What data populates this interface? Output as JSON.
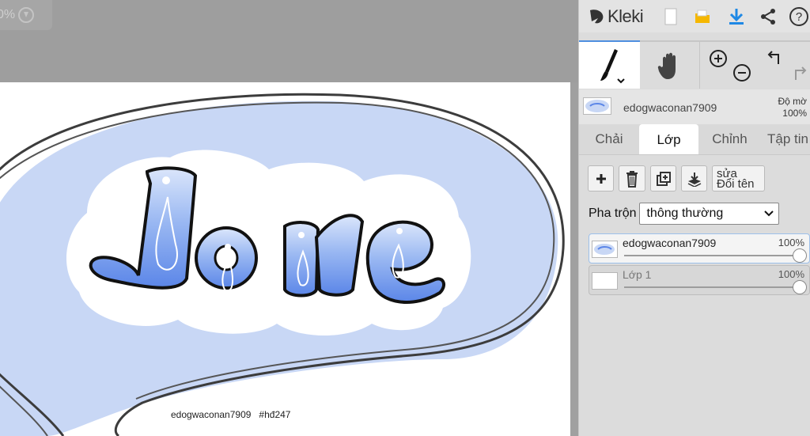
{
  "canvas": {
    "zoom_text": "0%",
    "signature": "edogwaconan7909   #hđ247"
  },
  "topbar": {
    "app_name": "Kleki"
  },
  "tools": {
    "brush": "brush-icon",
    "hand": "hand-icon",
    "zoom_in": "zoom-in-icon",
    "zoom_out": "zoom-out-icon",
    "undo": "undo-icon",
    "redo": "redo-icon"
  },
  "current_layer": {
    "name": "edogwaconan7909",
    "opacity_label": "Độ mờ",
    "opacity_value": "100%"
  },
  "tabs": [
    {
      "label": "Chải"
    },
    {
      "label": "Lớp"
    },
    {
      "label": "Chỉnh"
    },
    {
      "label": "Tập tin"
    }
  ],
  "layers_panel": {
    "rename_line1": "sửa",
    "rename_line2": "Đổi tên",
    "blend_label": "Pha trộn",
    "blend_value": "thông thường",
    "layers": [
      {
        "name": "edogwaconan7909",
        "opacity": "100%"
      },
      {
        "name": "Lớp 1",
        "opacity": "100%"
      }
    ]
  },
  "colors": {
    "accent": "#4e8fe0",
    "download_icon": "#1e88e5",
    "folder_icon": "#f5b700",
    "bubble_fill": "#c8d7f5",
    "letter_fill": "#7aa2ef"
  }
}
